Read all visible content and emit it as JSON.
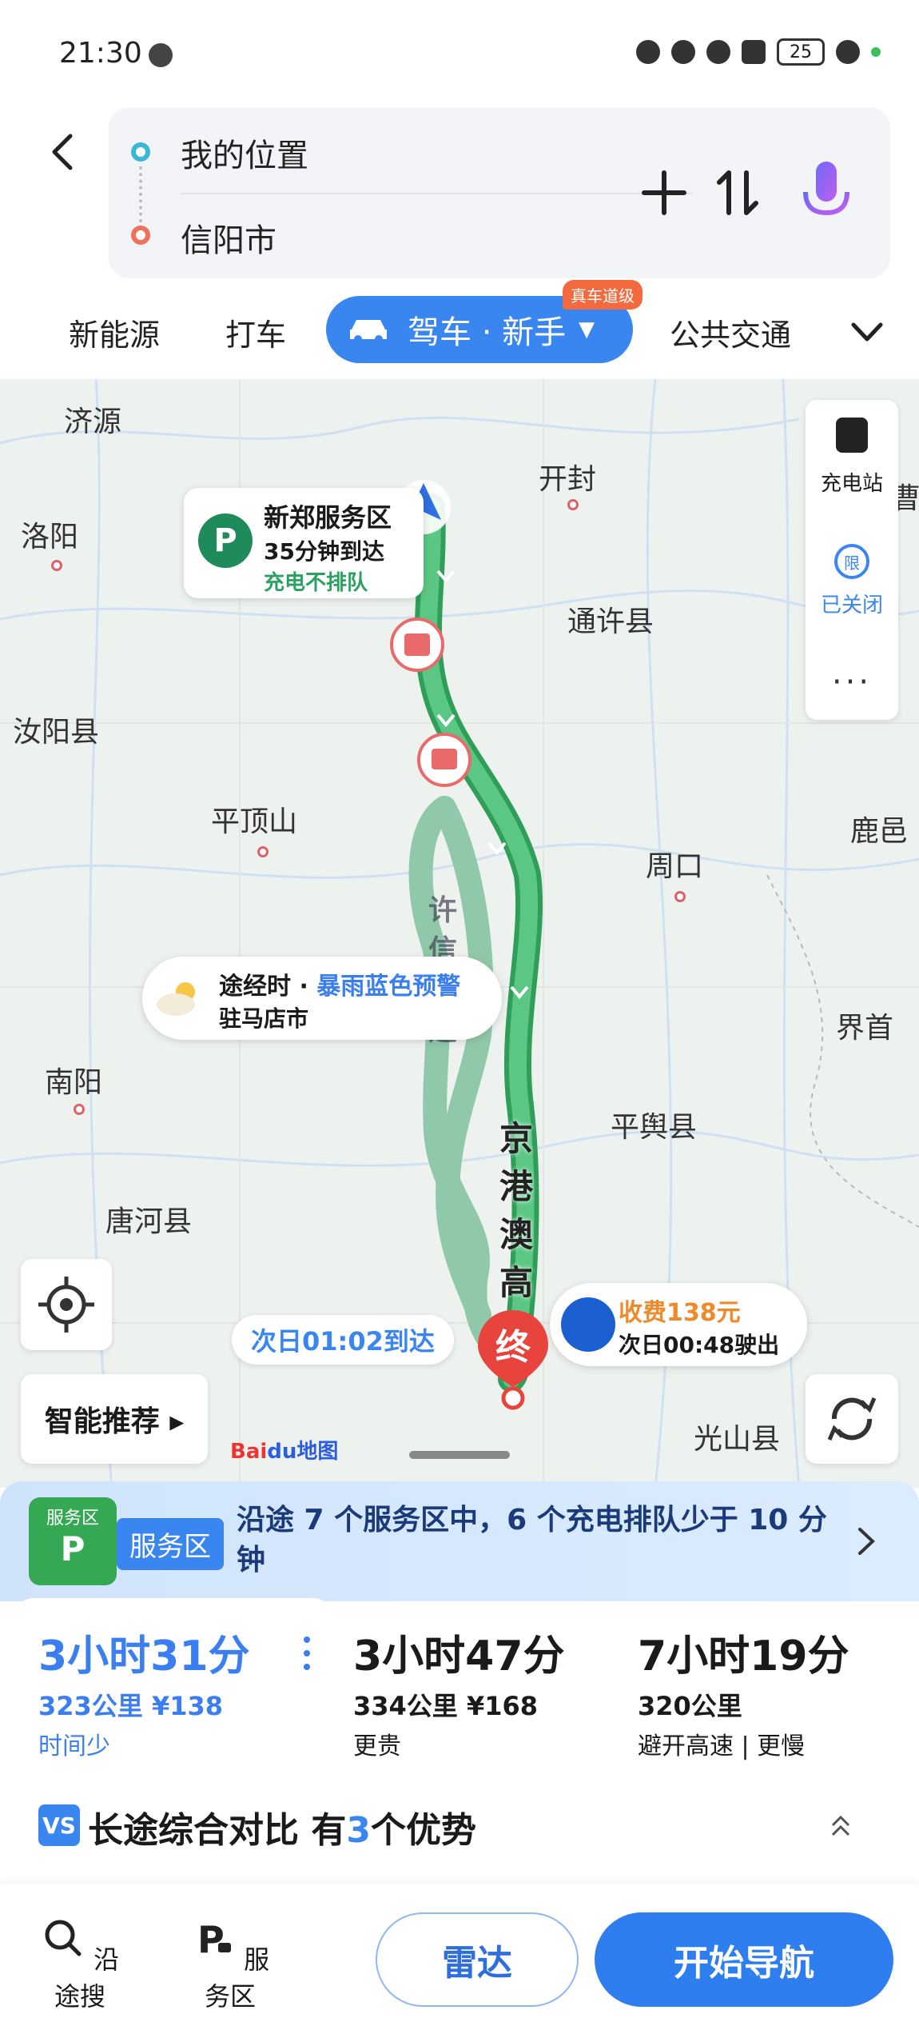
{
  "status_bar": {
    "time": "21:30",
    "battery": "25"
  },
  "route": {
    "from": "我的位置",
    "to": "信阳市"
  },
  "mode_tabs": {
    "ev": "新能源",
    "taxi": "打车",
    "drive": "驾车 · 新手",
    "drive_badge": "真车道级",
    "transit": "公共交通"
  },
  "map": {
    "cities": [
      {
        "name": "济源"
      },
      {
        "name": "开封"
      },
      {
        "name": "洛阳"
      },
      {
        "name": "通许县"
      },
      {
        "name": "汝阳县"
      },
      {
        "name": "平顶山"
      },
      {
        "name": "周口"
      },
      {
        "name": "鹿邑"
      },
      {
        "name": "界首"
      },
      {
        "name": "南阳"
      },
      {
        "name": "平舆县"
      },
      {
        "name": "唐河县"
      },
      {
        "name": "光山县"
      },
      {
        "name": "曹"
      }
    ],
    "side_panel": {
      "charging_label": "充电站",
      "limit_icon": "限",
      "limit_label": "已关闭",
      "more": "···"
    },
    "poi_card": {
      "icon": "P",
      "title": "新郑服务区",
      "subtitle": "35分钟到达",
      "note": "充电不排队"
    },
    "weather_card": {
      "prefix": "途经时 · ",
      "warning": "暴雨蓝色预警",
      "place": "驻马店市"
    },
    "road_label": "京港澳高",
    "alt_road_label": "许信高速",
    "arrive_pill": "次日01:02到达",
    "toll_card": {
      "fee": "收费138元",
      "exit": "次日00:48驶出"
    },
    "end_marker": "终",
    "smart_button": "智能推荐 ▸",
    "baidu_logo_a": "Bai",
    "baidu_logo_b": "du地图"
  },
  "sheet": {
    "service_banner": {
      "icon_label": "服务区",
      "tag": "服务区",
      "text": "沿途 7 个服务区中，6 个充电排队少于 10 分钟"
    },
    "routes": [
      {
        "time": "3小时31分",
        "meta": "323公里  ¥138",
        "tag": "时间少"
      },
      {
        "time": "3小时47分",
        "meta": "334公里  ¥168",
        "tag": "更贵"
      },
      {
        "time": "7小时19分",
        "meta": "320公里",
        "tag": "避开高速 | 更慢"
      }
    ],
    "compare": {
      "prefix": "长途综合对比 有",
      "count": "3",
      "suffix": "个优势",
      "vs_icon": "VS"
    }
  },
  "actions": {
    "search_along": "沿途搜",
    "service_area": "服务区",
    "radar": "雷达",
    "start_nav": "开始导航"
  }
}
